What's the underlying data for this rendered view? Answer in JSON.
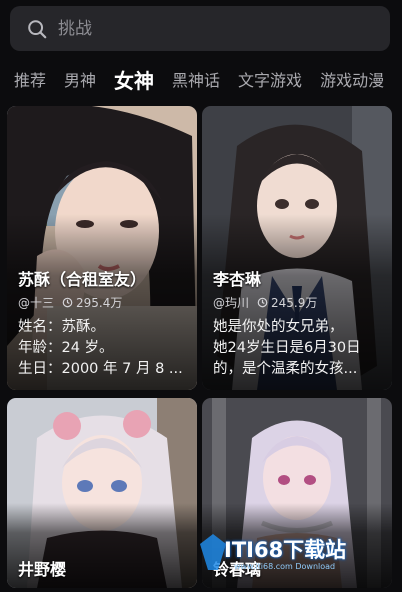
{
  "search": {
    "placeholder": "挑战"
  },
  "tabs": [
    {
      "label": "推荐",
      "active": false
    },
    {
      "label": "男神",
      "active": false
    },
    {
      "label": "女神",
      "active": true
    },
    {
      "label": "黑神话",
      "active": false
    },
    {
      "label": "文字游戏",
      "active": false
    },
    {
      "label": "游戏动漫",
      "active": false
    }
  ],
  "cards": [
    {
      "name": "苏酥（合租室友）",
      "author": "@十三",
      "heat": "295.4万",
      "desc": [
        "姓名：苏酥。",
        "年龄：24 岁。",
        "生日：2000 年 7 月 8 ..."
      ]
    },
    {
      "name": "李杏琳",
      "author": "@玙川",
      "heat": "245.9万",
      "desc": [
        "她是你处的女兄弟，",
        "她24岁生日是6月30日",
        "的，是个温柔的女孩..."
      ]
    },
    {
      "name": "井野樱",
      "author": "",
      "heat": "",
      "desc": []
    },
    {
      "name": "铃春璃",
      "author": "",
      "heat": "",
      "desc": []
    }
  ],
  "watermark": {
    "text": "ITI68下载站",
    "sub": "www.iti68.com Download"
  },
  "colors": {
    "background": "#0c0c0e",
    "search_bg": "#26262a",
    "tab_inactive": "#a9a9ae",
    "tab_active": "#ffffff"
  },
  "icons": {
    "search": "search-icon",
    "heat": "heat-icon"
  }
}
